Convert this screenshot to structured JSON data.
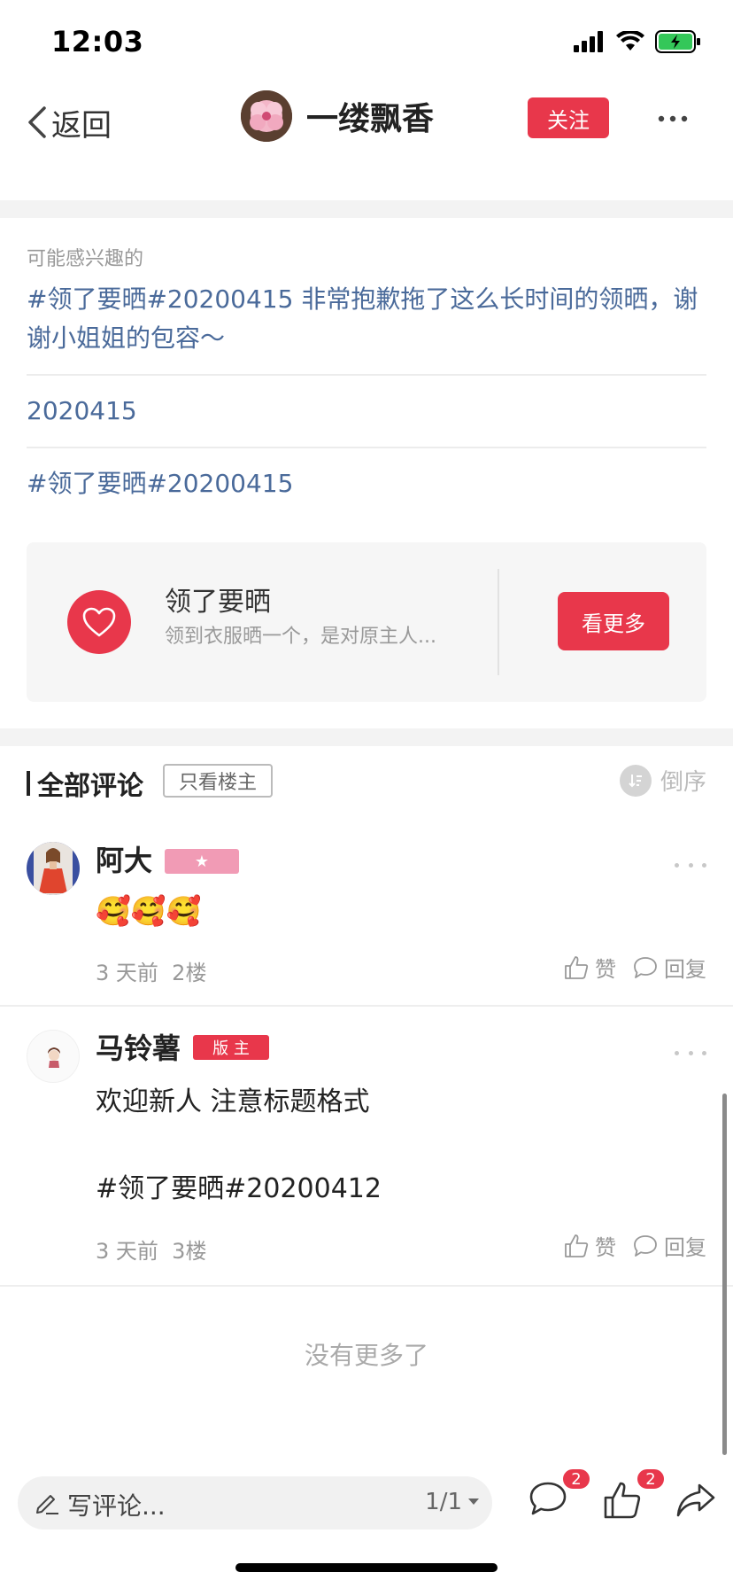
{
  "status": {
    "time": "12:03"
  },
  "nav": {
    "back_label": "返回",
    "user_name": "一缕飘香",
    "follow_label": "关注"
  },
  "interest": {
    "heading": "可能感兴趣的",
    "items": [
      "#领了要晒#20200415 非常抱歉拖了这么长时间的领晒，谢谢小姐姐的包容～",
      "2020415",
      "#领了要晒#20200415"
    ]
  },
  "topic": {
    "title": "领了要晒",
    "desc": "领到衣服晒一个，是对原主人...",
    "more_label": "看更多"
  },
  "comments_header": {
    "title": "全部评论",
    "filter_label": "只看楼主",
    "order_label": "倒序"
  },
  "comments": [
    {
      "name": "阿大",
      "badge": "★",
      "body": [
        "🥰🥰🥰"
      ],
      "time": "3 天前",
      "floor": "2楼",
      "like_label": "赞",
      "reply_label": "回复"
    },
    {
      "name": "马铃薯",
      "badge": "版 主",
      "body": [
        "欢迎新人 注意标题格式",
        "",
        "#领了要晒#20200412"
      ],
      "time": "3 天前",
      "floor": "3楼",
      "like_label": "赞",
      "reply_label": "回复"
    }
  ],
  "no_more": "没有更多了",
  "bottom": {
    "input_placeholder": "写评论...",
    "page": "1/1",
    "comment_count": "2",
    "like_count": "2"
  },
  "colors": {
    "accent": "#e8374b",
    "link": "#4a6a9a",
    "badge_pink": "#f19bb5"
  }
}
